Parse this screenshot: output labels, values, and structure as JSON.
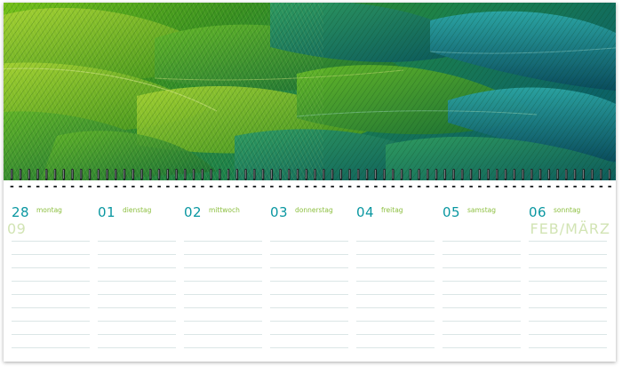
{
  "colors": {
    "accent": "#0a97a1",
    "weekday": "#8cbf3f",
    "watermark": "#d2e4b4",
    "rule": "#dbe6e6"
  },
  "image": {
    "subject": "green-parrot-feathers"
  },
  "week": {
    "number": "09"
  },
  "month_label": "FEB/MÄRZ",
  "days": [
    {
      "num": "28",
      "weekday": "montag"
    },
    {
      "num": "01",
      "weekday": "dienstag"
    },
    {
      "num": "02",
      "weekday": "mittwoch"
    },
    {
      "num": "03",
      "weekday": "donnerstag"
    },
    {
      "num": "04",
      "weekday": "freitag"
    },
    {
      "num": "05",
      "weekday": "samstag"
    },
    {
      "num": "06",
      "weekday": "sonntag"
    }
  ]
}
